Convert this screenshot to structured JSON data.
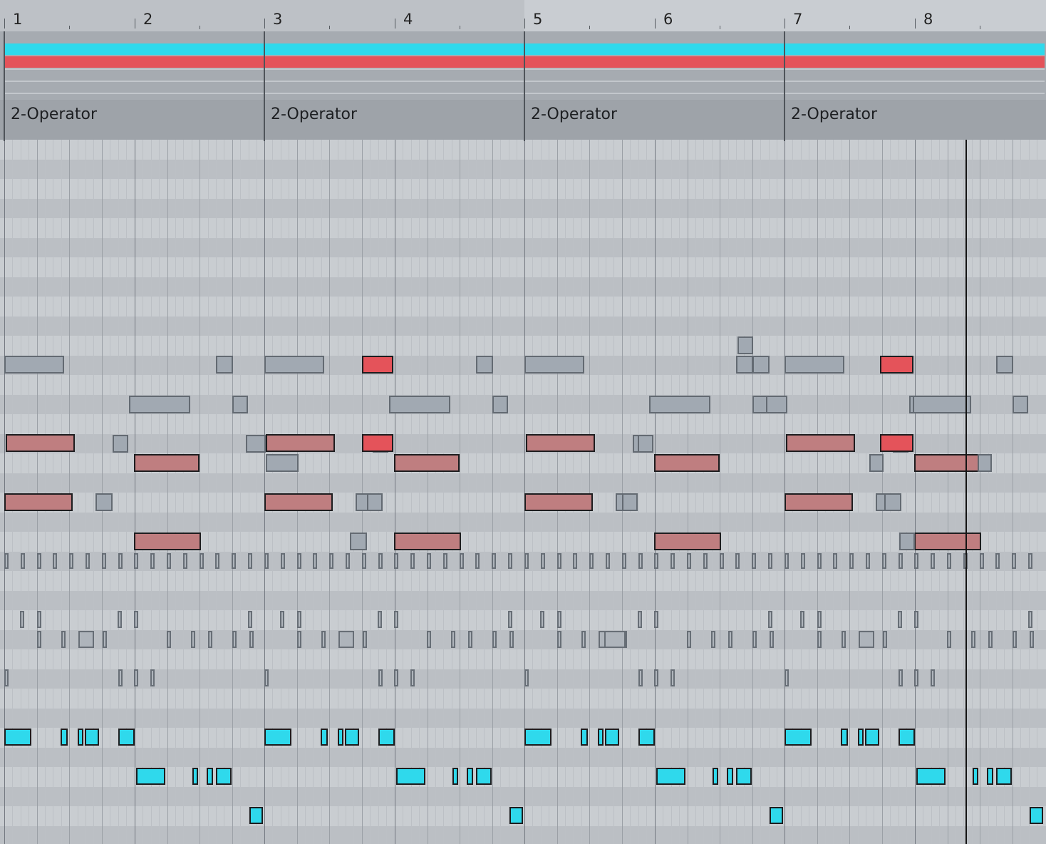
{
  "ruler": {
    "bars": [
      "1",
      "2",
      "3",
      "4",
      "5",
      "6",
      "7",
      "8"
    ]
  },
  "clips": [
    {
      "name": "2-Operator"
    },
    {
      "name": "2-Operator"
    },
    {
      "name": "2-Operator"
    },
    {
      "name": "2-Operator"
    }
  ],
  "colors": {
    "cyan": "#2fd9ec",
    "red": "#e4535a",
    "rose": "#bf7e80",
    "gray_note": "#a1a9b2"
  },
  "icons": {
    "playhead": "playhead-line"
  }
}
